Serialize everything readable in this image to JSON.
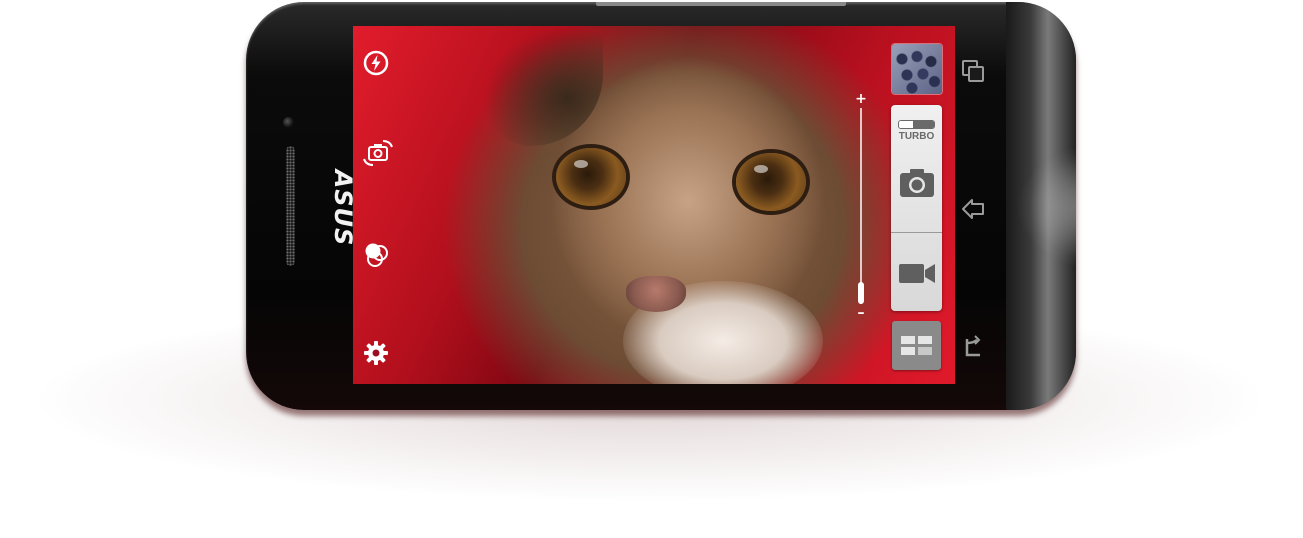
{
  "device": {
    "brand_logo": "ASUS"
  },
  "camera": {
    "left_toolbar": [
      {
        "icon": "flash-auto-icon"
      },
      {
        "icon": "switch-camera-icon"
      },
      {
        "icon": "color-effects-icon"
      },
      {
        "icon": "settings-gear-icon"
      }
    ],
    "zoom": {
      "plus_label": "+",
      "minus_label": "–",
      "level": 0.0
    },
    "capture_panel": {
      "turbo_label": "TURBO",
      "shutter_icon": "camera-icon",
      "video_icon": "video-camera-icon"
    },
    "mode_button_icon": "mode-grid-icon",
    "gallery_thumbnail_icon": "gallery-thumbnail"
  },
  "system_buttons": [
    {
      "icon": "recent-apps-icon"
    },
    {
      "icon": "home-icon"
    },
    {
      "icon": "back-icon"
    }
  ],
  "colors": {
    "screen_red": "#c51220",
    "panel_light": "#e6e6e6",
    "panel_icon": "#5f5f5f",
    "mode_button": "#8a8a8a"
  }
}
